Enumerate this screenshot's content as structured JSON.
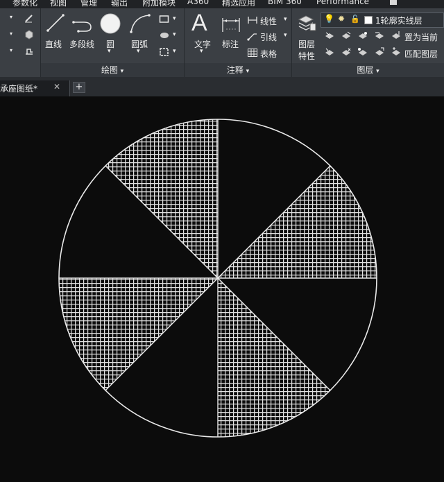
{
  "menubar": {
    "items": [
      {
        "label": "参数化"
      },
      {
        "label": "视图"
      },
      {
        "label": "管理"
      },
      {
        "label": "输出"
      },
      {
        "label": "附加模块"
      },
      {
        "label": "A360"
      },
      {
        "label": "精选应用"
      },
      {
        "label": "BIM 360"
      },
      {
        "label": "Performance"
      }
    ]
  },
  "ribbon": {
    "draw_panel": {
      "title": "绘图",
      "tools": {
        "line": "直线",
        "polyline": "多段线",
        "circle": "圆",
        "arc": "圆弧"
      }
    },
    "annotation_panel": {
      "title": "注释",
      "tools": {
        "text": "文字",
        "dimension": "标注",
        "linear": "线性",
        "leader": "引线",
        "table": "表格"
      }
    },
    "layers_panel": {
      "title": "图层",
      "tools": {
        "layer_properties_line1": "图层",
        "layer_properties_line2": "特性",
        "current_layer": "1轮廓实线层",
        "set_current": "置为当前",
        "match_layer": "匹配图层"
      }
    }
  },
  "document_tabs": {
    "active_tab": "承座图纸*",
    "close_glyph": "✕",
    "add_glyph": "+"
  },
  "drawing": {
    "background_color": "#0c0c0c",
    "line_color": "#e8e8e8",
    "hatch_pattern": "NET (grid)",
    "sectors": 8,
    "hatched_sectors": 4
  }
}
